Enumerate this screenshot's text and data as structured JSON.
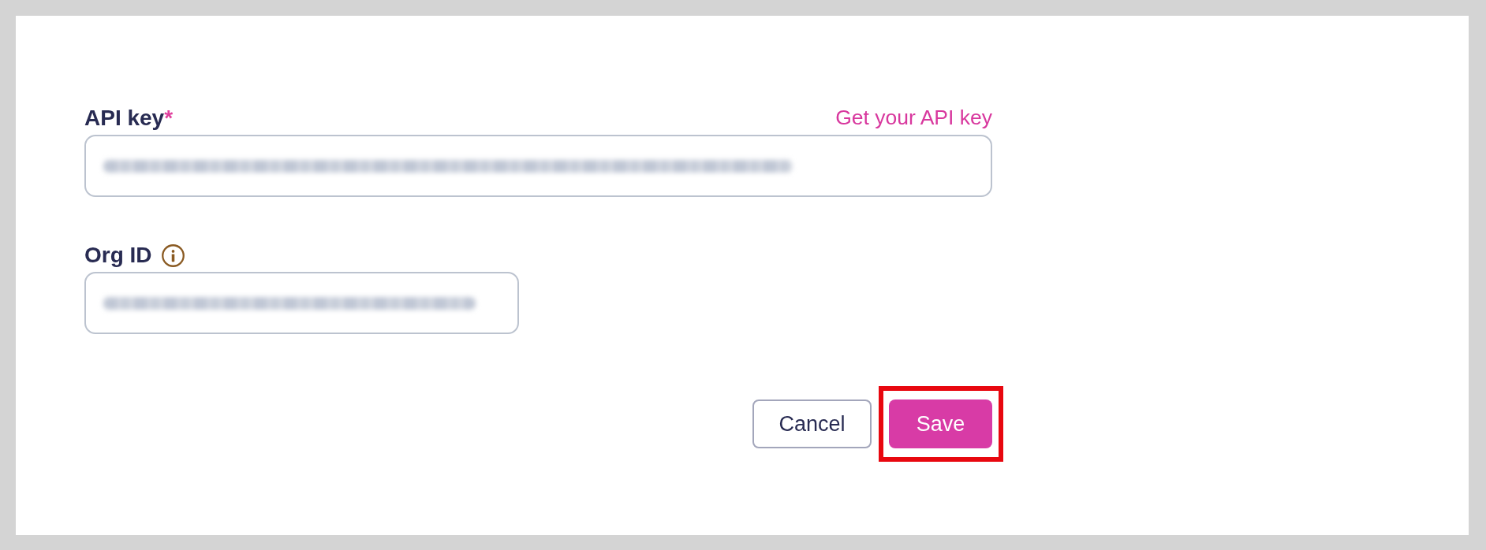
{
  "form": {
    "fields": [
      {
        "label": "API key",
        "required_mark": "*",
        "link": "Get your API key",
        "info": false
      },
      {
        "label": "Org ID",
        "info": true
      }
    ]
  },
  "buttons": [
    {
      "label": "Cancel",
      "kind": "secondary",
      "highlighted": false
    },
    {
      "label": "Save",
      "kind": "primary",
      "highlighted": true
    }
  ]
}
